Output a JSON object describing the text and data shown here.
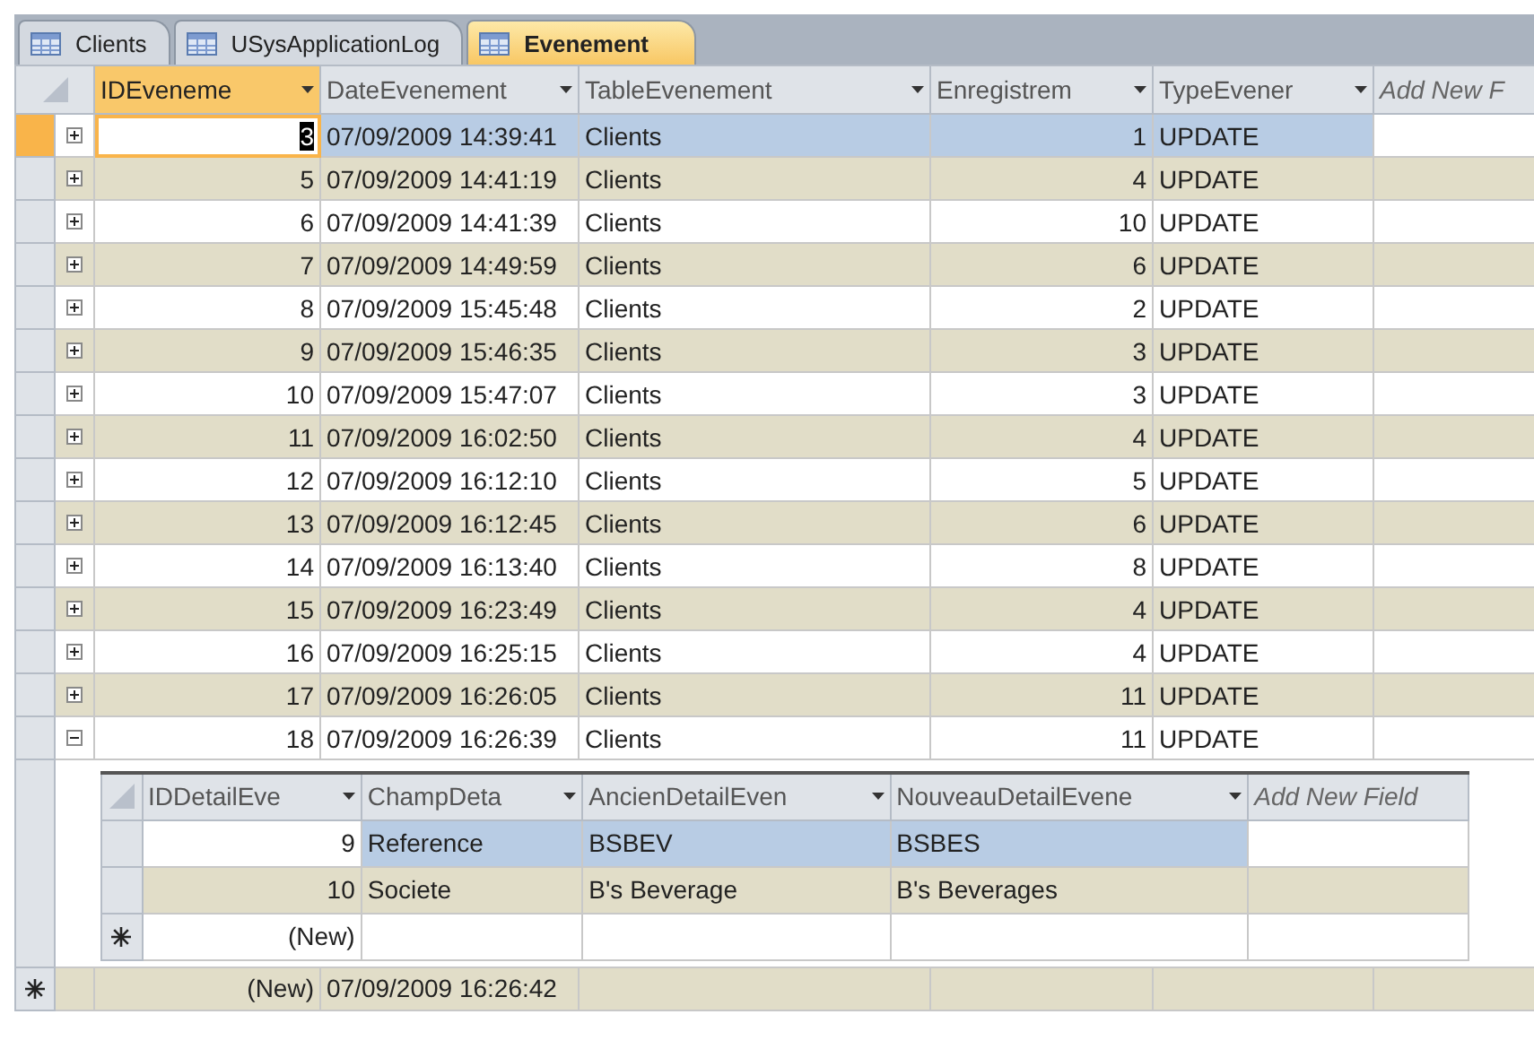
{
  "tabs": [
    {
      "label": "Clients",
      "selected": false
    },
    {
      "label": "USysApplicationLog",
      "selected": false
    },
    {
      "label": "Evenement",
      "selected": true
    }
  ],
  "columns": [
    {
      "label": "IDEveneme",
      "kind": "number",
      "selected": true
    },
    {
      "label": "DateEvenement",
      "kind": "text",
      "selected": false
    },
    {
      "label": "TableEvenement",
      "kind": "text",
      "selected": false
    },
    {
      "label": "Enregistrem",
      "kind": "number",
      "selected": false
    },
    {
      "label": "TypeEvener",
      "kind": "text",
      "selected": false
    },
    {
      "label": "Add New F",
      "kind": "add",
      "selected": false
    }
  ],
  "rows": [
    {
      "cells": [
        "3",
        "07/09/2009 14:39:41",
        "Clients",
        "1",
        "UPDATE"
      ],
      "selected": true,
      "expanded": false
    },
    {
      "cells": [
        "5",
        "07/09/2009 14:41:19",
        "Clients",
        "4",
        "UPDATE"
      ],
      "selected": false,
      "expanded": false
    },
    {
      "cells": [
        "6",
        "07/09/2009 14:41:39",
        "Clients",
        "10",
        "UPDATE"
      ],
      "selected": false,
      "expanded": false
    },
    {
      "cells": [
        "7",
        "07/09/2009 14:49:59",
        "Clients",
        "6",
        "UPDATE"
      ],
      "selected": false,
      "expanded": false
    },
    {
      "cells": [
        "8",
        "07/09/2009 15:45:48",
        "Clients",
        "2",
        "UPDATE"
      ],
      "selected": false,
      "expanded": false
    },
    {
      "cells": [
        "9",
        "07/09/2009 15:46:35",
        "Clients",
        "3",
        "UPDATE"
      ],
      "selected": false,
      "expanded": false
    },
    {
      "cells": [
        "10",
        "07/09/2009 15:47:07",
        "Clients",
        "3",
        "UPDATE"
      ],
      "selected": false,
      "expanded": false
    },
    {
      "cells": [
        "11",
        "07/09/2009 16:02:50",
        "Clients",
        "4",
        "UPDATE"
      ],
      "selected": false,
      "expanded": false
    },
    {
      "cells": [
        "12",
        "07/09/2009 16:12:10",
        "Clients",
        "5",
        "UPDATE"
      ],
      "selected": false,
      "expanded": false
    },
    {
      "cells": [
        "13",
        "07/09/2009 16:12:45",
        "Clients",
        "6",
        "UPDATE"
      ],
      "selected": false,
      "expanded": false
    },
    {
      "cells": [
        "14",
        "07/09/2009 16:13:40",
        "Clients",
        "8",
        "UPDATE"
      ],
      "selected": false,
      "expanded": false
    },
    {
      "cells": [
        "15",
        "07/09/2009 16:23:49",
        "Clients",
        "4",
        "UPDATE"
      ],
      "selected": false,
      "expanded": false
    },
    {
      "cells": [
        "16",
        "07/09/2009 16:25:15",
        "Clients",
        "4",
        "UPDATE"
      ],
      "selected": false,
      "expanded": false
    },
    {
      "cells": [
        "17",
        "07/09/2009 16:26:05",
        "Clients",
        "11",
        "UPDATE"
      ],
      "selected": false,
      "expanded": false
    },
    {
      "cells": [
        "18",
        "07/09/2009 16:26:39",
        "Clients",
        "11",
        "UPDATE"
      ],
      "selected": false,
      "expanded": true,
      "details": {
        "columns": [
          {
            "label": "IDDetailEve",
            "kind": "number"
          },
          {
            "label": "ChampDeta",
            "kind": "text"
          },
          {
            "label": "AncienDetailEven",
            "kind": "text"
          },
          {
            "label": "NouveauDetailEvene",
            "kind": "text"
          },
          {
            "label": "Add New Field",
            "kind": "add"
          }
        ],
        "rows": [
          {
            "cells": [
              "9",
              "Reference",
              "BSBEV",
              "BSBES"
            ],
            "selected": true
          },
          {
            "cells": [
              "10",
              "Societe",
              "B's Beverage",
              "B's Beverages"
            ],
            "selected": false
          }
        ],
        "new_row": {
          "cells": [
            "(New)"
          ]
        }
      }
    }
  ],
  "new_row": {
    "cells": [
      "(New)",
      "07/09/2009 16:26:42"
    ]
  }
}
